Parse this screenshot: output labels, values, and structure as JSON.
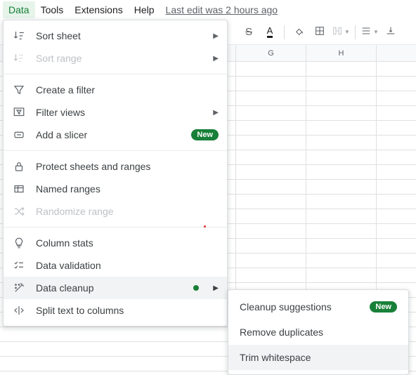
{
  "menubar": {
    "data": "Data",
    "tools": "Tools",
    "extensions": "Extensions",
    "help": "Help",
    "last_edit": "Last edit was 2 hours ago"
  },
  "toolbar": {
    "strike": "S",
    "text_color": "A"
  },
  "columns": {
    "g": "G",
    "h": "H"
  },
  "menu": {
    "sort_sheet": "Sort sheet",
    "sort_range": "Sort range",
    "create_filter": "Create a filter",
    "filter_views": "Filter views",
    "add_slicer": "Add a slicer",
    "protect": "Protect sheets and ranges",
    "named_ranges": "Named ranges",
    "randomize_range": "Randomize range",
    "column_stats": "Column stats",
    "data_validation": "Data validation",
    "data_cleanup": "Data cleanup",
    "split_text": "Split text to columns",
    "new_badge": "New"
  },
  "submenu": {
    "cleanup_suggestions": "Cleanup suggestions",
    "remove_duplicates": "Remove duplicates",
    "trim_whitespace": "Trim whitespace",
    "new_badge": "New"
  }
}
